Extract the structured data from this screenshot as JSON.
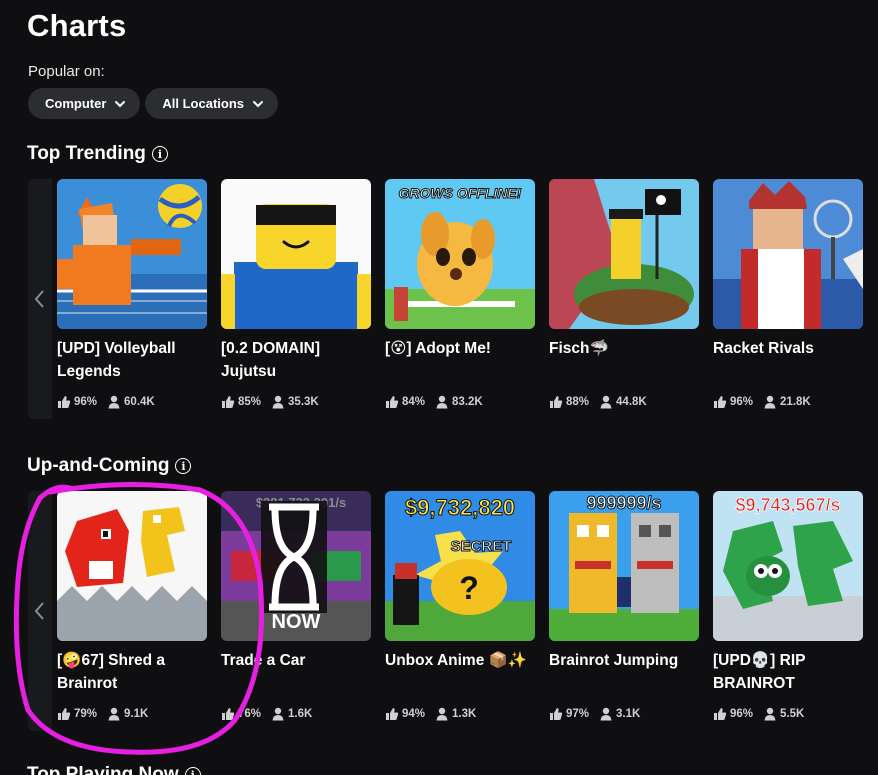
{
  "page": {
    "title": "Charts"
  },
  "filters": {
    "label": "Popular on:",
    "device": "Computer",
    "location": "All Locations"
  },
  "sections": {
    "trending": {
      "title": "Top Trending",
      "games": [
        {
          "title": "[UPD] Volleyball Legends",
          "rating": "96%",
          "players": "60.4K"
        },
        {
          "title": "[0.2 DOMAIN] Jujutsu",
          "rating": "85%",
          "players": "35.3K"
        },
        {
          "title": "[😵] Adopt Me!",
          "rating": "84%",
          "players": "83.2K",
          "thumb_text": "GROWS OFFLINE!"
        },
        {
          "title": "Fisch🦈",
          "rating": "88%",
          "players": "44.8K"
        },
        {
          "title": "Racket Rivals",
          "rating": "96%",
          "players": "21.8K"
        }
      ]
    },
    "upcoming": {
      "title": "Up-and-Coming",
      "games": [
        {
          "title": "[🤪67] Shred a Brainrot",
          "rating": "79%",
          "players": "9.1K"
        },
        {
          "title": "Trade a Car",
          "rating": "76%",
          "players": "1.6K",
          "thumb_text": "NOW",
          "thumb_top_text": "$281,732,391/s"
        },
        {
          "title": "Unbox Anime 📦✨",
          "rating": "94%",
          "players": "1.3K",
          "thumb_text": "$9,732,820",
          "thumb_badge": "SECRET"
        },
        {
          "title": "Brainrot Jumping",
          "rating": "97%",
          "players": "3.1K",
          "thumb_text": "999999/s"
        },
        {
          "title": "[UPD💀] RIP BRAINROT",
          "rating": "96%",
          "players": "5.5K",
          "thumb_text": "$9,743,567/s"
        }
      ]
    },
    "playing_now": {
      "title": "Top Playing Now"
    }
  },
  "colors": {
    "background": "#0f0f11",
    "chip": "#2b2d30",
    "annotation": "#e61fe0"
  }
}
